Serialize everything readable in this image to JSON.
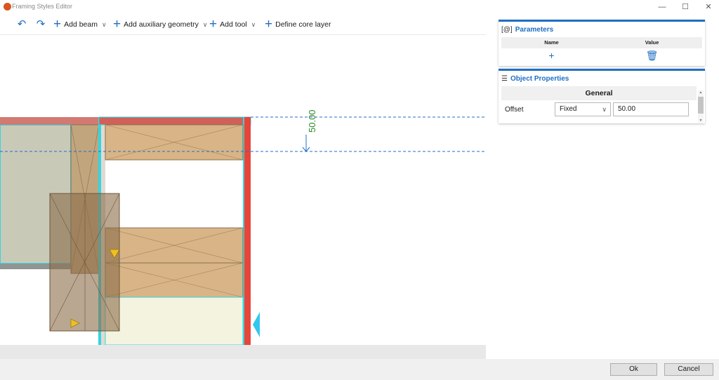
{
  "window": {
    "title": "Framing Styles Editor"
  },
  "toolbar": {
    "undo_icon": "undo-icon",
    "redo_icon": "redo-icon",
    "add_beam": "Add beam",
    "add_aux": "Add auxiliary geometry",
    "add_tool": "Add tool",
    "define_core": "Define core layer"
  },
  "canvas": {
    "dimension_label": "50.00"
  },
  "parameters": {
    "title": "Parameters",
    "icon": "[@]",
    "col_name": "Name",
    "col_value": "Value"
  },
  "object_properties": {
    "title": "Object Properties",
    "group": "General",
    "offset_label": "Offset",
    "offset_mode": "Fixed",
    "offset_value": "50.00"
  },
  "footer": {
    "ok": "Ok",
    "cancel": "Cancel"
  },
  "colors": {
    "accent": "#1f6fc4",
    "cyan": "#33d6e0",
    "red": "#e8443a",
    "wood": "#d8b486"
  }
}
